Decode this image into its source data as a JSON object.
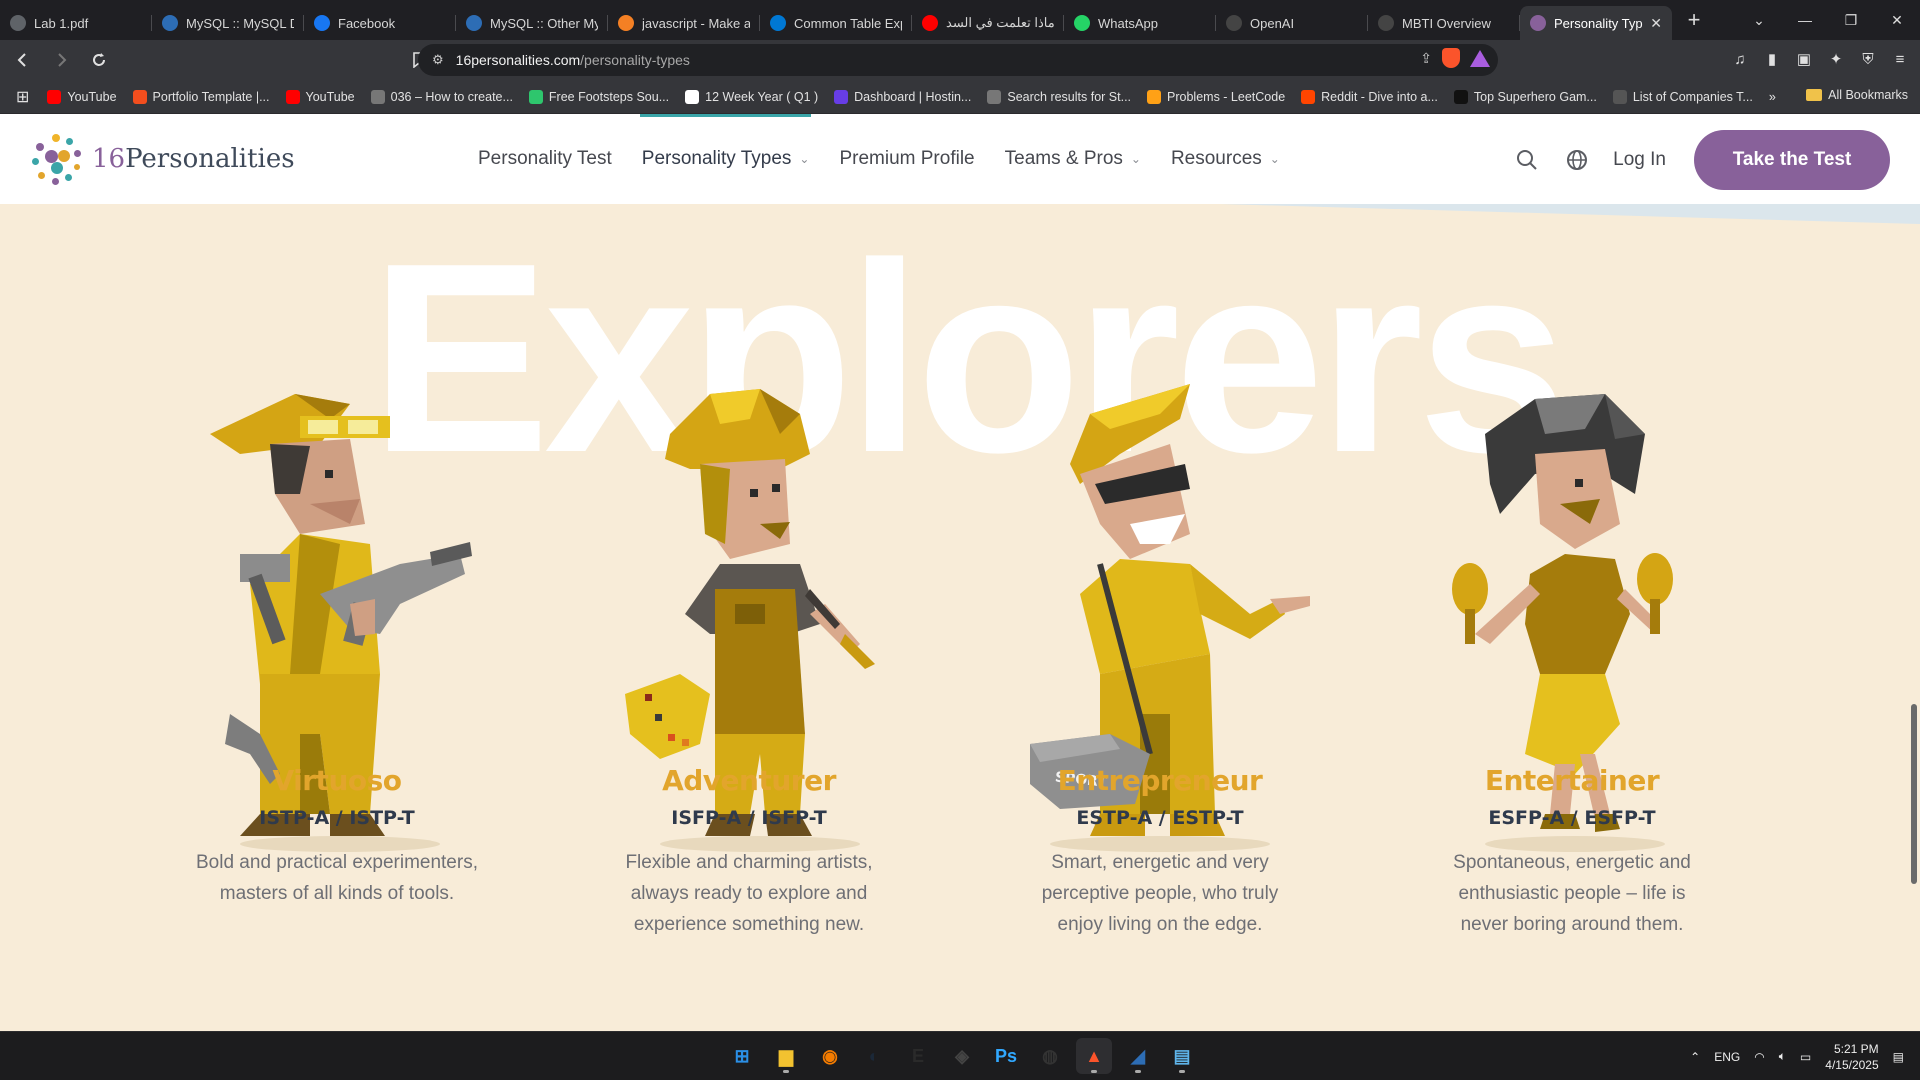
{
  "browser": {
    "tabs": [
      {
        "title": "Lab 1.pdf",
        "icon": "globe-icon",
        "color": "#5f6368"
      },
      {
        "title": "MySQL :: MySQL Dc",
        "icon": "mysql-icon",
        "color": "#2d6db5"
      },
      {
        "title": "Facebook",
        "icon": "facebook-icon",
        "color": "#1877f2"
      },
      {
        "title": "MySQL :: Other My",
        "icon": "mysql-icon",
        "color": "#2d6db5"
      },
      {
        "title": "javascript - Make a",
        "icon": "stackoverflow-icon",
        "color": "#f48024"
      },
      {
        "title": "Common Table Exp",
        "icon": "azure-icon",
        "color": "#0078d4"
      },
      {
        "title": "ماذا تعلمت في السد",
        "icon": "youtube-icon",
        "color": "#ff0000"
      },
      {
        "title": "WhatsApp",
        "icon": "whatsapp-icon",
        "color": "#25d366"
      },
      {
        "title": "OpenAI",
        "icon": "openai-icon",
        "color": "#444444"
      },
      {
        "title": "MBTI Overview",
        "icon": "openai-icon",
        "color": "#444444"
      },
      {
        "title": "Personality Typ",
        "icon": "16p-icon",
        "color": "#88619a",
        "active": true
      }
    ],
    "new_tab": "+",
    "url_host": "16personalities.com",
    "url_path": "/personality-types",
    "bookmarks": [
      {
        "label": "YouTube",
        "icon": "youtube-icon",
        "color": "#ff0000"
      },
      {
        "label": "Portfolio Template |...",
        "icon": "figma-icon",
        "color": "#f24e1e"
      },
      {
        "label": "YouTube",
        "icon": "youtube-icon",
        "color": "#ff0000"
      },
      {
        "label": "036 – How to create...",
        "icon": "globe-icon",
        "color": "#777777"
      },
      {
        "label": "Free Footsteps Sou...",
        "icon": "pixabay-icon",
        "color": "#2ec66d"
      },
      {
        "label": "12 Week Year ( Q1 )",
        "icon": "notion-icon",
        "color": "#ffffff"
      },
      {
        "label": "Dashboard | Hostin...",
        "icon": "hostinger-icon",
        "color": "#673de6"
      },
      {
        "label": "Search results for St...",
        "icon": "globe-icon",
        "color": "#777777"
      },
      {
        "label": "Problems - LeetCode",
        "icon": "leetcode-icon",
        "color": "#ffa116"
      },
      {
        "label": "Reddit - Dive into a...",
        "icon": "reddit-icon",
        "color": "#ff4500"
      },
      {
        "label": "Top Superhero Gam...",
        "icon": "gs-icon",
        "color": "#111111"
      },
      {
        "label": "List of Companies T...",
        "icon": "companies-icon",
        "color": "#555555"
      }
    ],
    "all_bookmarks": "All Bookmarks"
  },
  "site": {
    "logo_number": "16",
    "logo_word": "Personalities",
    "nav": [
      {
        "label": "Personality Test",
        "dropdown": false
      },
      {
        "label": "Personality Types",
        "dropdown": true,
        "current": true
      },
      {
        "label": "Premium Profile",
        "dropdown": false
      },
      {
        "label": "Teams & Pros",
        "dropdown": true
      },
      {
        "label": "Resources",
        "dropdown": true
      }
    ],
    "login": "Log In",
    "cta": "Take the Test",
    "accent": "#88619a"
  },
  "section": {
    "heading": "Explorers",
    "types": [
      {
        "name": "Virtuoso",
        "code": "ISTP-A / ISTP-T",
        "desc_lines": [
          "Bold and practical experimenters,",
          "masters of all kinds of tools."
        ]
      },
      {
        "name": "Adventurer",
        "code": "ISFP-A / ISFP-T",
        "desc_lines": [
          "Flexible and charming artists,",
          "always ready to explore and",
          "experience something new."
        ]
      },
      {
        "name": "Entrepreneur",
        "code": "ESTP-A / ESTP-T",
        "desc_lines": [
          "Smart, energetic and very",
          "perceptive people, who truly",
          "enjoy living on the edge."
        ]
      },
      {
        "name": "Entertainer",
        "code": "ESFP-A / ESFP-T",
        "desc_lines": [
          "Spontaneous, energetic and",
          "enthusiastic people – life is",
          "never boring around them."
        ]
      }
    ],
    "bag_label": "SPORT",
    "title_color": "#e2a52c"
  },
  "taskbar": {
    "apps": [
      "windows-icon",
      "file-explorer-icon",
      "blender-icon",
      "steam-icon",
      "epic-games-icon",
      "unity-icon",
      "photoshop-icon",
      "obs-icon",
      "brave-icon",
      "mysql-workbench-icon",
      "notepad-icon"
    ],
    "lang": "ENG",
    "time": "5:21 PM",
    "date": "4/15/2025"
  }
}
